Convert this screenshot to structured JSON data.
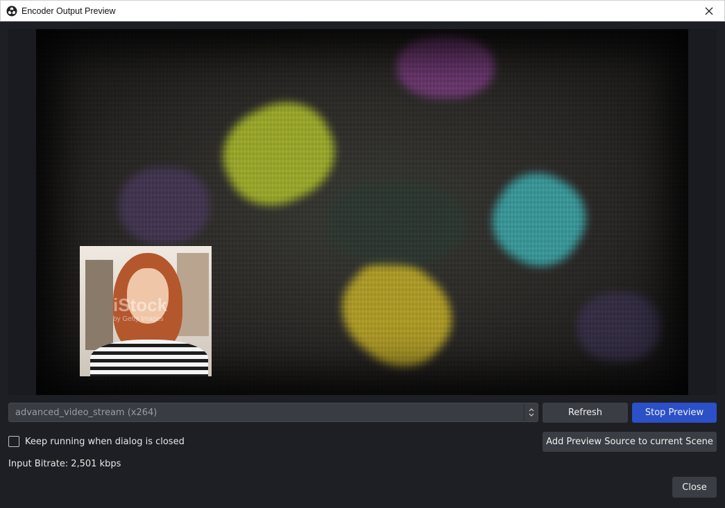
{
  "window": {
    "title": "Encoder Output Preview",
    "app_icon": "obs-logo-icon",
    "close_icon": "close-icon"
  },
  "preview": {
    "webcam_watermark": "iStock",
    "webcam_watermark_sub": "by Getty Images"
  },
  "controls": {
    "encoder_select_value": "advanced_video_stream (x264)",
    "refresh_label": "Refresh",
    "stop_preview_label": "Stop Preview",
    "keep_running_label": "Keep running when dialog is closed",
    "keep_running_checked": false,
    "add_preview_source_label": "Add Preview Source to current Scene",
    "bitrate_label": "Input Bitrate:",
    "bitrate_value": "2,501 kbps",
    "close_label": "Close"
  },
  "colors": {
    "accent": "#2b50c8",
    "background": "#1e1f24",
    "button": "#3b3d44"
  }
}
